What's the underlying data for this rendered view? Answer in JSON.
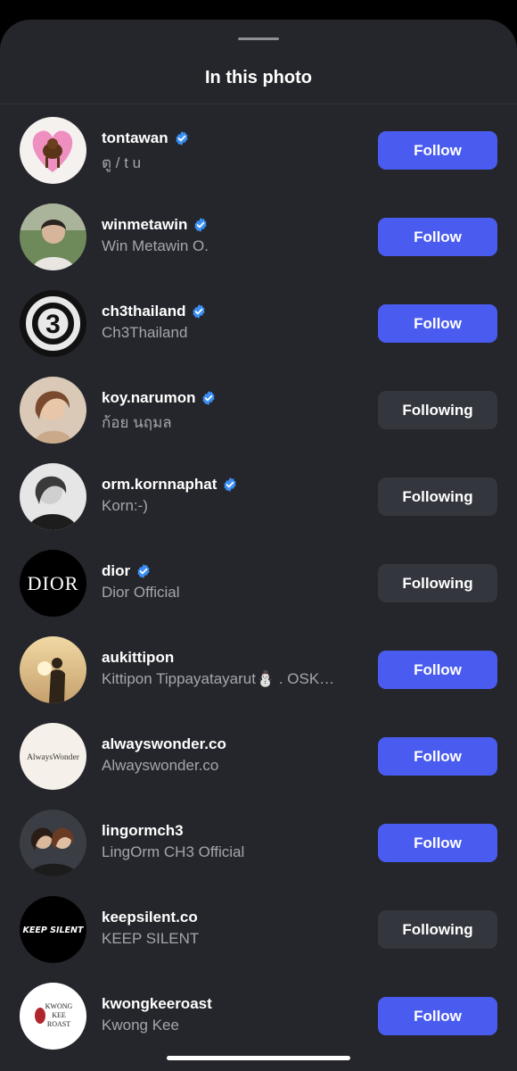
{
  "sheet": {
    "title": "In this photo"
  },
  "colors": {
    "follow_bg": "#4a5cf0",
    "following_bg": "#34363d",
    "verified": "#3b8ff5",
    "sheet_bg": "#25262b"
  },
  "people": [
    {
      "username": "tontawan",
      "full_name": "ตู / t u",
      "verified": true,
      "button": "Follow",
      "state": "follow",
      "avatar": "pink-heart-dog"
    },
    {
      "username": "winmetawin",
      "full_name": "Win Metawin O.",
      "verified": true,
      "button": "Follow",
      "state": "follow",
      "avatar": "portrait-outdoor"
    },
    {
      "username": "ch3thailand",
      "full_name": "Ch3Thailand",
      "verified": true,
      "button": "Follow",
      "state": "follow",
      "avatar": "ch3-logo"
    },
    {
      "username": "koy.narumon",
      "full_name": "ก้อย นฤมล",
      "verified": true,
      "button": "Following",
      "state": "following",
      "avatar": "portrait-warm"
    },
    {
      "username": "orm.kornnaphat",
      "full_name": "Korn:-)",
      "verified": true,
      "button": "Following",
      "state": "following",
      "avatar": "portrait-bw"
    },
    {
      "username": "dior",
      "full_name": "Dior Official",
      "verified": true,
      "button": "Following",
      "state": "following",
      "avatar": "dior-logo"
    },
    {
      "username": "aukittipon",
      "full_name": "Kittipon Tippayatayarut⛄ . OSK…",
      "verified": false,
      "button": "Follow",
      "state": "follow",
      "avatar": "sunset-silhouette"
    },
    {
      "username": "alwayswonder.co",
      "full_name": "Alwayswonder.co",
      "verified": false,
      "button": "Follow",
      "state": "follow",
      "avatar": "alwayswonder-logo"
    },
    {
      "username": "lingormch3",
      "full_name": "LingOrm CH3 Official",
      "verified": false,
      "button": "Follow",
      "state": "follow",
      "avatar": "duo-portrait"
    },
    {
      "username": "keepsilent.co",
      "full_name": "KEEP SILENT",
      "verified": false,
      "button": "Following",
      "state": "following",
      "avatar": "keepsilent-logo"
    },
    {
      "username": "kwongkeeroast",
      "full_name": "Kwong Kee",
      "verified": false,
      "button": "Follow",
      "state": "follow",
      "avatar": "kwongkee-logo"
    }
  ],
  "logos": {
    "ch3": "3",
    "dior": "DIOR",
    "alwayswonder": "AlwaysWonder",
    "keepsilent": "KEEP SILENT",
    "kwongkee": [
      "KWONG",
      "KEE",
      "ROAST"
    ]
  }
}
